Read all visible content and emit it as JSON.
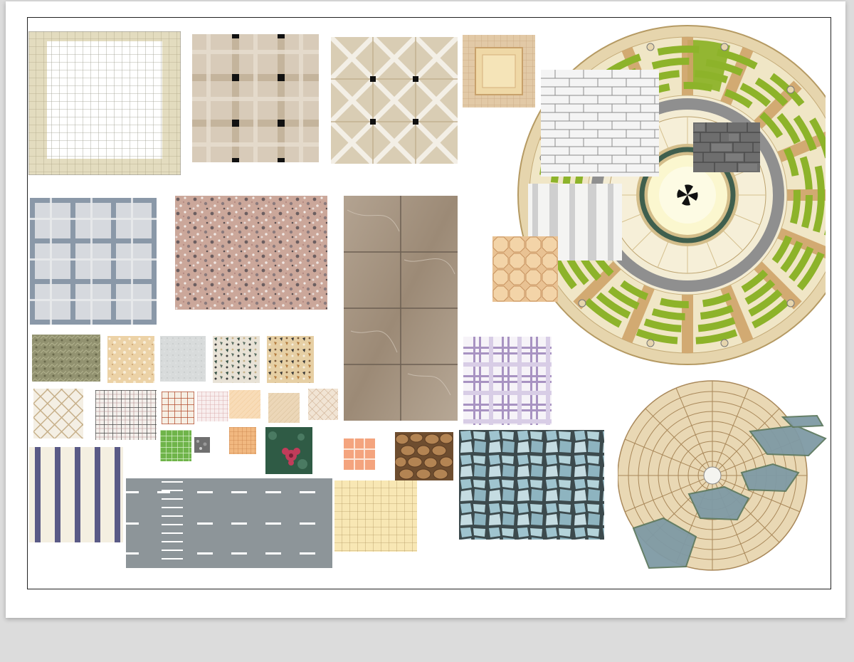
{
  "sheet": {
    "paper": "#ffffff",
    "backdrop": "#dcdcdc",
    "frame_color": "#222222"
  },
  "palette": {
    "beige": "#e6dcc0",
    "tan": "#c9b48a",
    "green": "#8db32a",
    "slate": "#8a98a8",
    "asphalt": "#8d9599",
    "brick": "#f2f2f2",
    "lilac": "#8c72a8",
    "salmon": "#f0a07a",
    "stone_blue": "#8fb2bf"
  }
}
